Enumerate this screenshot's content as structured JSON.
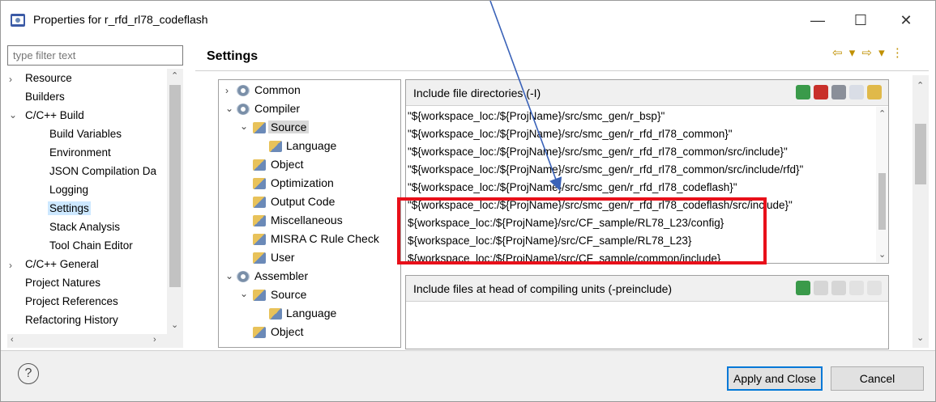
{
  "window": {
    "title": "Properties for r_rfd_rl78_codeflash",
    "minimize": "—",
    "maximize": "☐",
    "close": "✕"
  },
  "filter": {
    "placeholder": "type filter text"
  },
  "nav": {
    "items": [
      {
        "label": "Resource",
        "expandable": true
      },
      {
        "label": "Builders"
      },
      {
        "label": "C/C++ Build",
        "expanded": true
      },
      {
        "label": "Build Variables"
      },
      {
        "label": "Environment"
      },
      {
        "label": "JSON Compilation Da"
      },
      {
        "label": "Logging"
      },
      {
        "label": "Settings",
        "selected": true
      },
      {
        "label": "Stack Analysis"
      },
      {
        "label": "Tool Chain Editor"
      },
      {
        "label": "C/C++ General",
        "expandable": true
      },
      {
        "label": "Project Natures"
      },
      {
        "label": "Project References"
      },
      {
        "label": "Refactoring History"
      }
    ]
  },
  "settings": {
    "title": "Settings",
    "nav_arrows": "⇦ ▾ ⇨ ▾ ⋮"
  },
  "tool_tree": {
    "items": [
      {
        "label": "Common"
      },
      {
        "label": "Compiler"
      },
      {
        "label": "Source",
        "selected": true
      },
      {
        "label": "Language"
      },
      {
        "label": "Object"
      },
      {
        "label": "Optimization"
      },
      {
        "label": "Output Code"
      },
      {
        "label": "Miscellaneous"
      },
      {
        "label": "MISRA C Rule Check"
      },
      {
        "label": "User"
      },
      {
        "label": "Assembler"
      },
      {
        "label": "Source"
      },
      {
        "label": "Language"
      },
      {
        "label": "Object"
      }
    ]
  },
  "include_dirs": {
    "header": "Include file directories (-I)",
    "rows": [
      "\"${workspace_loc:/${ProjName}/src/smc_gen/r_bsp}\"",
      "\"${workspace_loc:/${ProjName}/src/smc_gen/r_rfd_rl78_common}\"",
      "\"${workspace_loc:/${ProjName}/src/smc_gen/r_rfd_rl78_common/src/include}\"",
      "\"${workspace_loc:/${ProjName}/src/smc_gen/r_rfd_rl78_common/src/include/rfd}\"",
      "\"${workspace_loc:/${ProjName}/src/smc_gen/r_rfd_rl78_codeflash}\"",
      "\"${workspace_loc:/${ProjName}/src/smc_gen/r_rfd_rl78_codeflash/src/include}\"",
      "${workspace_loc:/${ProjName}/src/CF_sample/RL78_L23/config}",
      "${workspace_loc:/${ProjName}/src/CF_sample/RL78_L23}",
      "${workspace_loc:/${ProjName}/src/CF_sample/common/include}"
    ]
  },
  "preinclude": {
    "header": "Include files at head of compiling units (-preinclude)"
  },
  "buttons": {
    "help": "?",
    "apply_close": "Apply and Close",
    "cancel": "Cancel"
  },
  "colors": {
    "highlight": "#e8101a",
    "selection": "#cde8ff",
    "arrow": "#3a62b8"
  }
}
